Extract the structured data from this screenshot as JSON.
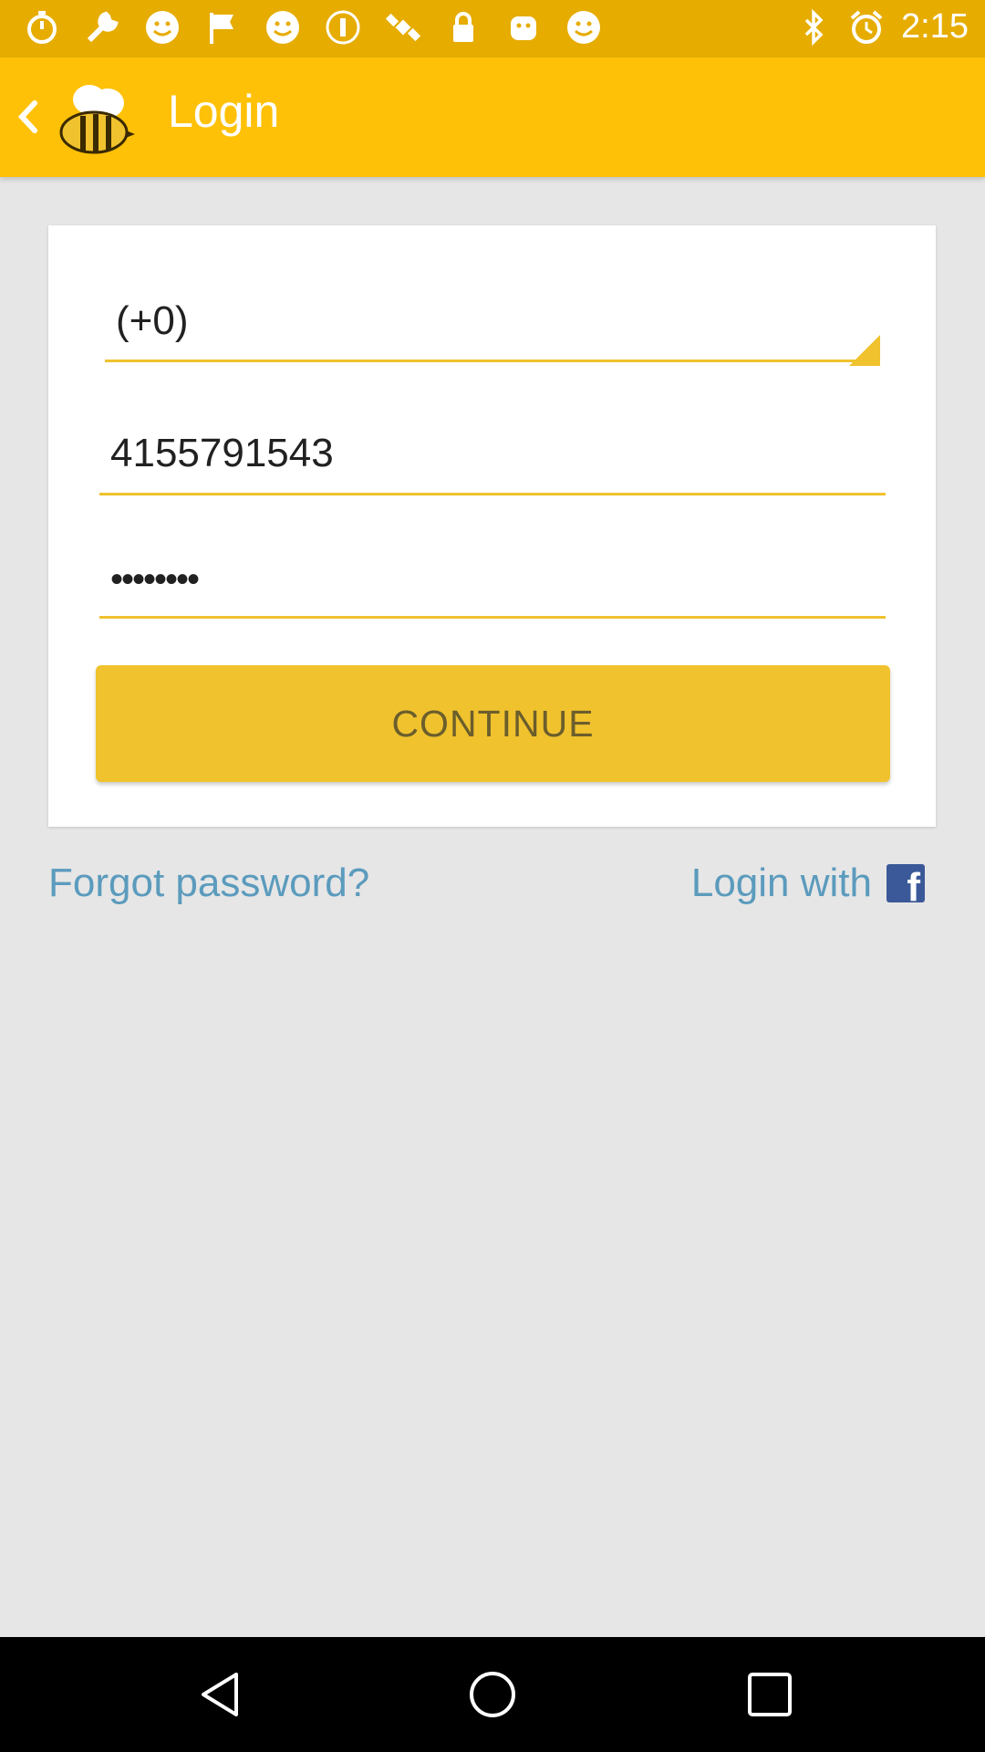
{
  "status_bar": {
    "time": "2:15",
    "left_icons": [
      "stopwatch-icon",
      "wrench-icon",
      "smiley-icon",
      "flag-icon",
      "smiley-icon",
      "coin-icon",
      "satellite-icon",
      "lock-icon",
      "android-icon",
      "smiley-icon"
    ],
    "right_icons": [
      "bluetooth-icon",
      "alarm-icon"
    ]
  },
  "appbar": {
    "title": "Login"
  },
  "form": {
    "country_code": "(+0)",
    "phone": "4155791543",
    "password": "••••••••"
  },
  "buttons": {
    "continue": "CONTINUE"
  },
  "links": {
    "forgot": "Forgot password?",
    "login_with": "Login with",
    "facebook_glyph": "f"
  },
  "colors": {
    "status_bar": "#e6ac00",
    "app_bar": "#ffc107",
    "accent": "#f0c22e",
    "link": "#5b9bbd",
    "facebook": "#3b5998"
  }
}
